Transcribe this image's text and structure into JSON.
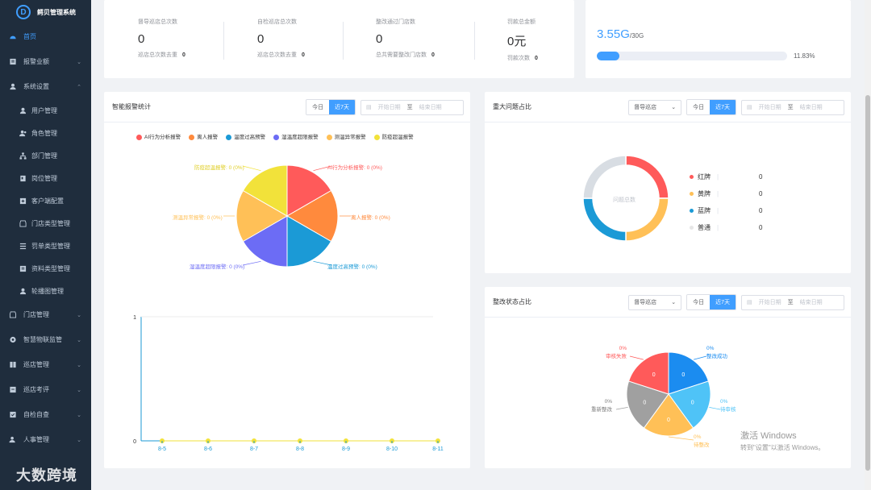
{
  "app": {
    "title": "鳄贝管理系统",
    "logo_glyph": "D"
  },
  "sidebar": {
    "items": [
      {
        "label": "首页",
        "icon": "dashboard-icon",
        "active": true
      },
      {
        "label": "报警业额",
        "icon": "document-icon",
        "arrow": "⌄"
      },
      {
        "label": "系统设置",
        "icon": "user-icon",
        "arrow": "⌃"
      }
    ],
    "sub_items": [
      {
        "label": "用户管理",
        "icon": "user-icon"
      },
      {
        "label": "角色管理",
        "icon": "user-group-icon"
      },
      {
        "label": "部门管理",
        "icon": "org-icon"
      },
      {
        "label": "岗位管理",
        "icon": "post-icon"
      },
      {
        "label": "客户端配置",
        "icon": "config-icon"
      },
      {
        "label": "门店类型管理",
        "icon": "store-icon"
      },
      {
        "label": "罚单类型管理",
        "icon": "list-icon"
      },
      {
        "label": "资料类型管理",
        "icon": "document-icon"
      },
      {
        "label": "轮播图管理",
        "icon": "image-icon"
      }
    ],
    "items2": [
      {
        "label": "门店管理",
        "icon": "store-icon",
        "arrow": "⌄"
      },
      {
        "label": "智慧物联监管",
        "icon": "iot-icon",
        "arrow": "⌄"
      },
      {
        "label": "巡店管理",
        "icon": "grid-icon",
        "arrow": "⌄"
      },
      {
        "label": "巡店考评",
        "icon": "evaluate-icon",
        "arrow": "⌄"
      },
      {
        "label": "自检自查",
        "icon": "check-icon",
        "arrow": "⌄"
      },
      {
        "label": "人事管理",
        "icon": "people-icon",
        "arrow": "⌄"
      }
    ]
  },
  "stats": [
    {
      "label": "督导巡店总次数",
      "value": "0",
      "sub_label": "巡店总次数去重",
      "sub_value": "0"
    },
    {
      "label": "自检巡店总次数",
      "value": "0",
      "sub_label": "巡店总次数去重",
      "sub_value": "0"
    },
    {
      "label": "整改通过门店数",
      "value": "0",
      "sub_label": "总共需要整改门店数",
      "sub_value": "0"
    },
    {
      "label": "罚款总金额",
      "value": "0元",
      "sub_label": "罚款次数",
      "sub_value": "0"
    }
  ],
  "storage": {
    "used": "3.55G",
    "total": "/30G",
    "percent_text": "11.83%",
    "percent": 11.83
  },
  "controls": {
    "today": "今日",
    "seven_days": "近7天",
    "start_date": "开始日期",
    "to": "至",
    "end_date": "结束日期",
    "select_value": "督导巡店"
  },
  "alarm_chart": {
    "title": "智能报警统计",
    "legend": [
      {
        "name": "AI行为分析报警",
        "color": "#ff5a5a"
      },
      {
        "name": "离人报警",
        "color": "#ff8a3d"
      },
      {
        "name": "温度过高预警",
        "color": "#1b9ad6"
      },
      {
        "name": "湿温度超限报警",
        "color": "#6c6cf5"
      },
      {
        "name": "测温异常报警",
        "color": "#ffc057"
      },
      {
        "name": "防疫超温报警",
        "color": "#f2e23a"
      }
    ],
    "pie_labels": [
      "AI行为分析报警: 0 (0%)",
      "离人报警: 0 (0%)",
      "温度过高预警: 0 (0%)",
      "湿温度超限报警: 0 (0%)",
      "测温异常报警: 0 (0%)",
      "防疫超温报警: 0 (0%)"
    ],
    "line": {
      "y_max": "1",
      "y_min": "0",
      "x": [
        "8-5",
        "8-6",
        "8-7",
        "8-8",
        "8-9",
        "8-10",
        "8-11"
      ]
    }
  },
  "major_chart": {
    "title": "重大问题占比",
    "center_label": "问题总数",
    "legend": [
      {
        "name": "红牌",
        "value": "0",
        "color": "#ff5a5a"
      },
      {
        "name": "黄牌",
        "value": "0",
        "color": "#ffc057"
      },
      {
        "name": "蓝牌",
        "value": "0",
        "color": "#1b9ad6"
      },
      {
        "name": "普通",
        "value": "0",
        "color": "#e6e6e6"
      }
    ]
  },
  "rectify_chart": {
    "title": "整改状态占比",
    "slices": [
      {
        "pct": "0%",
        "name": "整改成功",
        "value": "0",
        "color": "#1b8cf0"
      },
      {
        "pct": "0%",
        "name": "待审核",
        "value": "0",
        "color": "#4fc3f7"
      },
      {
        "pct": "0%",
        "name": "待整改",
        "value": "0",
        "color": "#ffc057"
      },
      {
        "pct": "0%",
        "name": "重新整改",
        "value": "0",
        "color": "#a0a0a0"
      },
      {
        "pct": "0%",
        "name": "审核失败",
        "value": "0",
        "color": "#ff5a5a"
      }
    ]
  },
  "watermark": {
    "line1": "激活 Windows",
    "line2": "转到\"设置\"以激活 Windows。"
  },
  "bottom_logo": "大数跨境"
}
